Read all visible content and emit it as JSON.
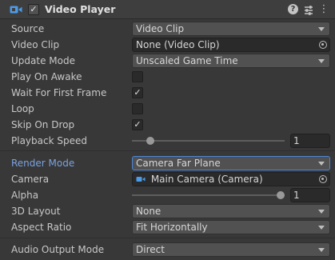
{
  "component": {
    "title": "Video Player",
    "enabled_check": "✓",
    "icons": [
      "video-player-icon",
      "help-icon",
      "preset-icon",
      "more-menu-icon"
    ]
  },
  "fields": {
    "source": {
      "label": "Source",
      "value": "Video Clip"
    },
    "video_clip": {
      "label": "Video Clip",
      "value": "None (Video Clip)"
    },
    "update_mode": {
      "label": "Update Mode",
      "value": "Unscaled Game Time"
    },
    "play_on_awake": {
      "label": "Play On Awake",
      "checked": false,
      "mark": ""
    },
    "wait_first_frame": {
      "label": "Wait For First Frame",
      "checked": true,
      "mark": "✓"
    },
    "loop": {
      "label": "Loop",
      "checked": false,
      "mark": ""
    },
    "skip_on_drop": {
      "label": "Skip On Drop",
      "checked": true,
      "mark": "✓"
    },
    "playback_speed": {
      "label": "Playback Speed",
      "value": "1",
      "slider_fraction": 0.1
    },
    "render_mode": {
      "label": "Render Mode",
      "value": "Camera Far Plane"
    },
    "camera": {
      "label": "Camera",
      "value": "Main Camera (Camera)"
    },
    "alpha": {
      "label": "Alpha",
      "value": "1",
      "slider_fraction": 1.0
    },
    "layout_3d": {
      "label": "3D Layout",
      "value": "None"
    },
    "aspect_ratio": {
      "label": "Aspect Ratio",
      "value": "Fit Horizontally"
    },
    "audio_output_mode": {
      "label": "Audio Output Mode",
      "value": "Direct"
    }
  },
  "colors": {
    "background": "#383838",
    "highlight_label": "#7ba2e0",
    "focus_border": "#4a86d6",
    "icon_blue": "#4b9be8"
  }
}
